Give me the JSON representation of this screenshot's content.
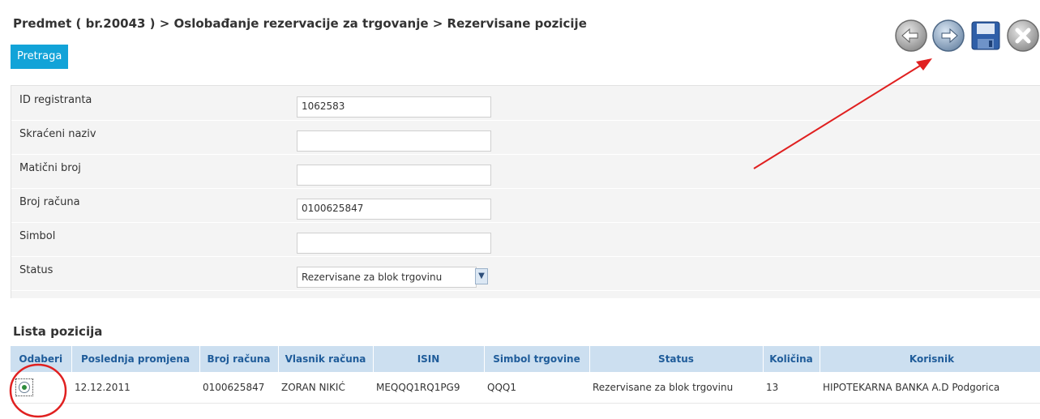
{
  "header": {
    "breadcrumb": "Predmet ( br.20043 ) > Oslobađanje rezervacije za trgovanje > Rezervisane pozicije",
    "search_button": "Pretraga"
  },
  "toolbar": {
    "icons": [
      "back-arrow-icon",
      "forward-arrow-icon",
      "save-icon",
      "close-icon"
    ]
  },
  "form": {
    "fields": [
      {
        "label": "ID registranta",
        "value": ""
      },
      {
        "label": "Skraćeni naziv",
        "value": ""
      },
      {
        "label": "Matični broj",
        "value": ""
      },
      {
        "label": "Broj računa",
        "value": "0100625847"
      },
      {
        "label": "Simbol",
        "value": ""
      },
      {
        "label": "Status",
        "value": "Rezervisane za blok trgovinu"
      }
    ],
    "id_value": "1062583"
  },
  "list": {
    "title": "Lista pozicija",
    "columns": [
      "Odaberi",
      "Poslednja promjena",
      "Broj računa",
      "Vlasnik računa",
      "ISIN",
      "Simbol trgovine",
      "Status",
      "Količina",
      "Korisnik"
    ],
    "rows": [
      {
        "selected": true,
        "date": "12.12.2011",
        "account": "0100625847",
        "owner": "ZORAN NIKIĆ",
        "isin": "MEQQQ1RQ1PG9",
        "symbol": "QQQ1",
        "status": "Rezervisane za blok trgovinu",
        "quantity": "13",
        "user": "HIPOTEKARNA BANKA A.D Podgorica"
      }
    ]
  },
  "colors": {
    "accent": "#12a3d8",
    "header_bg": "#ccdff0",
    "header_text": "#1f5c9a",
    "annotation": "#e02020"
  }
}
